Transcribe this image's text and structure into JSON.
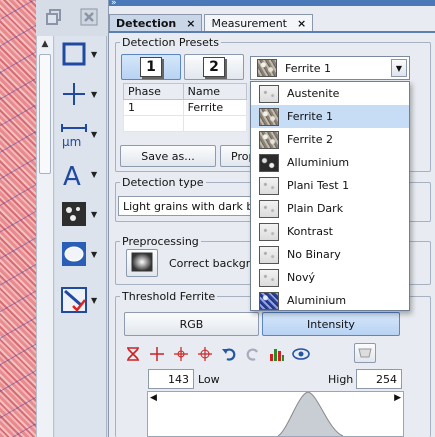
{
  "tabs": [
    {
      "label": "Detection"
    },
    {
      "label": "Measurement"
    }
  ],
  "close_glyph": "×",
  "detection_presets": {
    "title": "Detection Presets",
    "preset_buttons": [
      "1",
      "2"
    ],
    "selected_preset": "Ferrite 1",
    "table_headers": [
      "Phase",
      "Name"
    ],
    "table_rows": [
      [
        "1",
        "Ferrite"
      ]
    ],
    "save_as_label": "Save as...",
    "properties_label": "Prop"
  },
  "dropdown": {
    "items": [
      {
        "label": "Austenite",
        "icon": "sw-light"
      },
      {
        "label": "Ferrite 1",
        "icon": "sw-grain",
        "selected": true
      },
      {
        "label": "Ferrite 2",
        "icon": "sw-grain"
      },
      {
        "label": "Alluminium",
        "icon": "sw-dark"
      },
      {
        "label": "Plani Test 1",
        "icon": "sw-light"
      },
      {
        "label": "Plain Dark",
        "icon": "sw-light"
      },
      {
        "label": "Kontrast",
        "icon": "sw-light"
      },
      {
        "label": "No Binary",
        "icon": "sw-light"
      },
      {
        "label": "Nový",
        "icon": "sw-light"
      },
      {
        "label": "Aluminium",
        "icon": "sw-blue"
      }
    ]
  },
  "detection_type": {
    "title": "Detection type",
    "value": "Light grains with dark boun"
  },
  "preprocessing": {
    "title": "Preprocessing",
    "correct_label": "Correct backgrou"
  },
  "threshold": {
    "title": "Threshold Ferrite",
    "rgb_label": "RGB",
    "intensity_label": "Intensity",
    "low_value": "143",
    "low_label": "Low",
    "high_label": "High",
    "high_value": "254"
  },
  "colors": {
    "accent": "#4a78b8",
    "selected_item": "#c7dcf5"
  }
}
